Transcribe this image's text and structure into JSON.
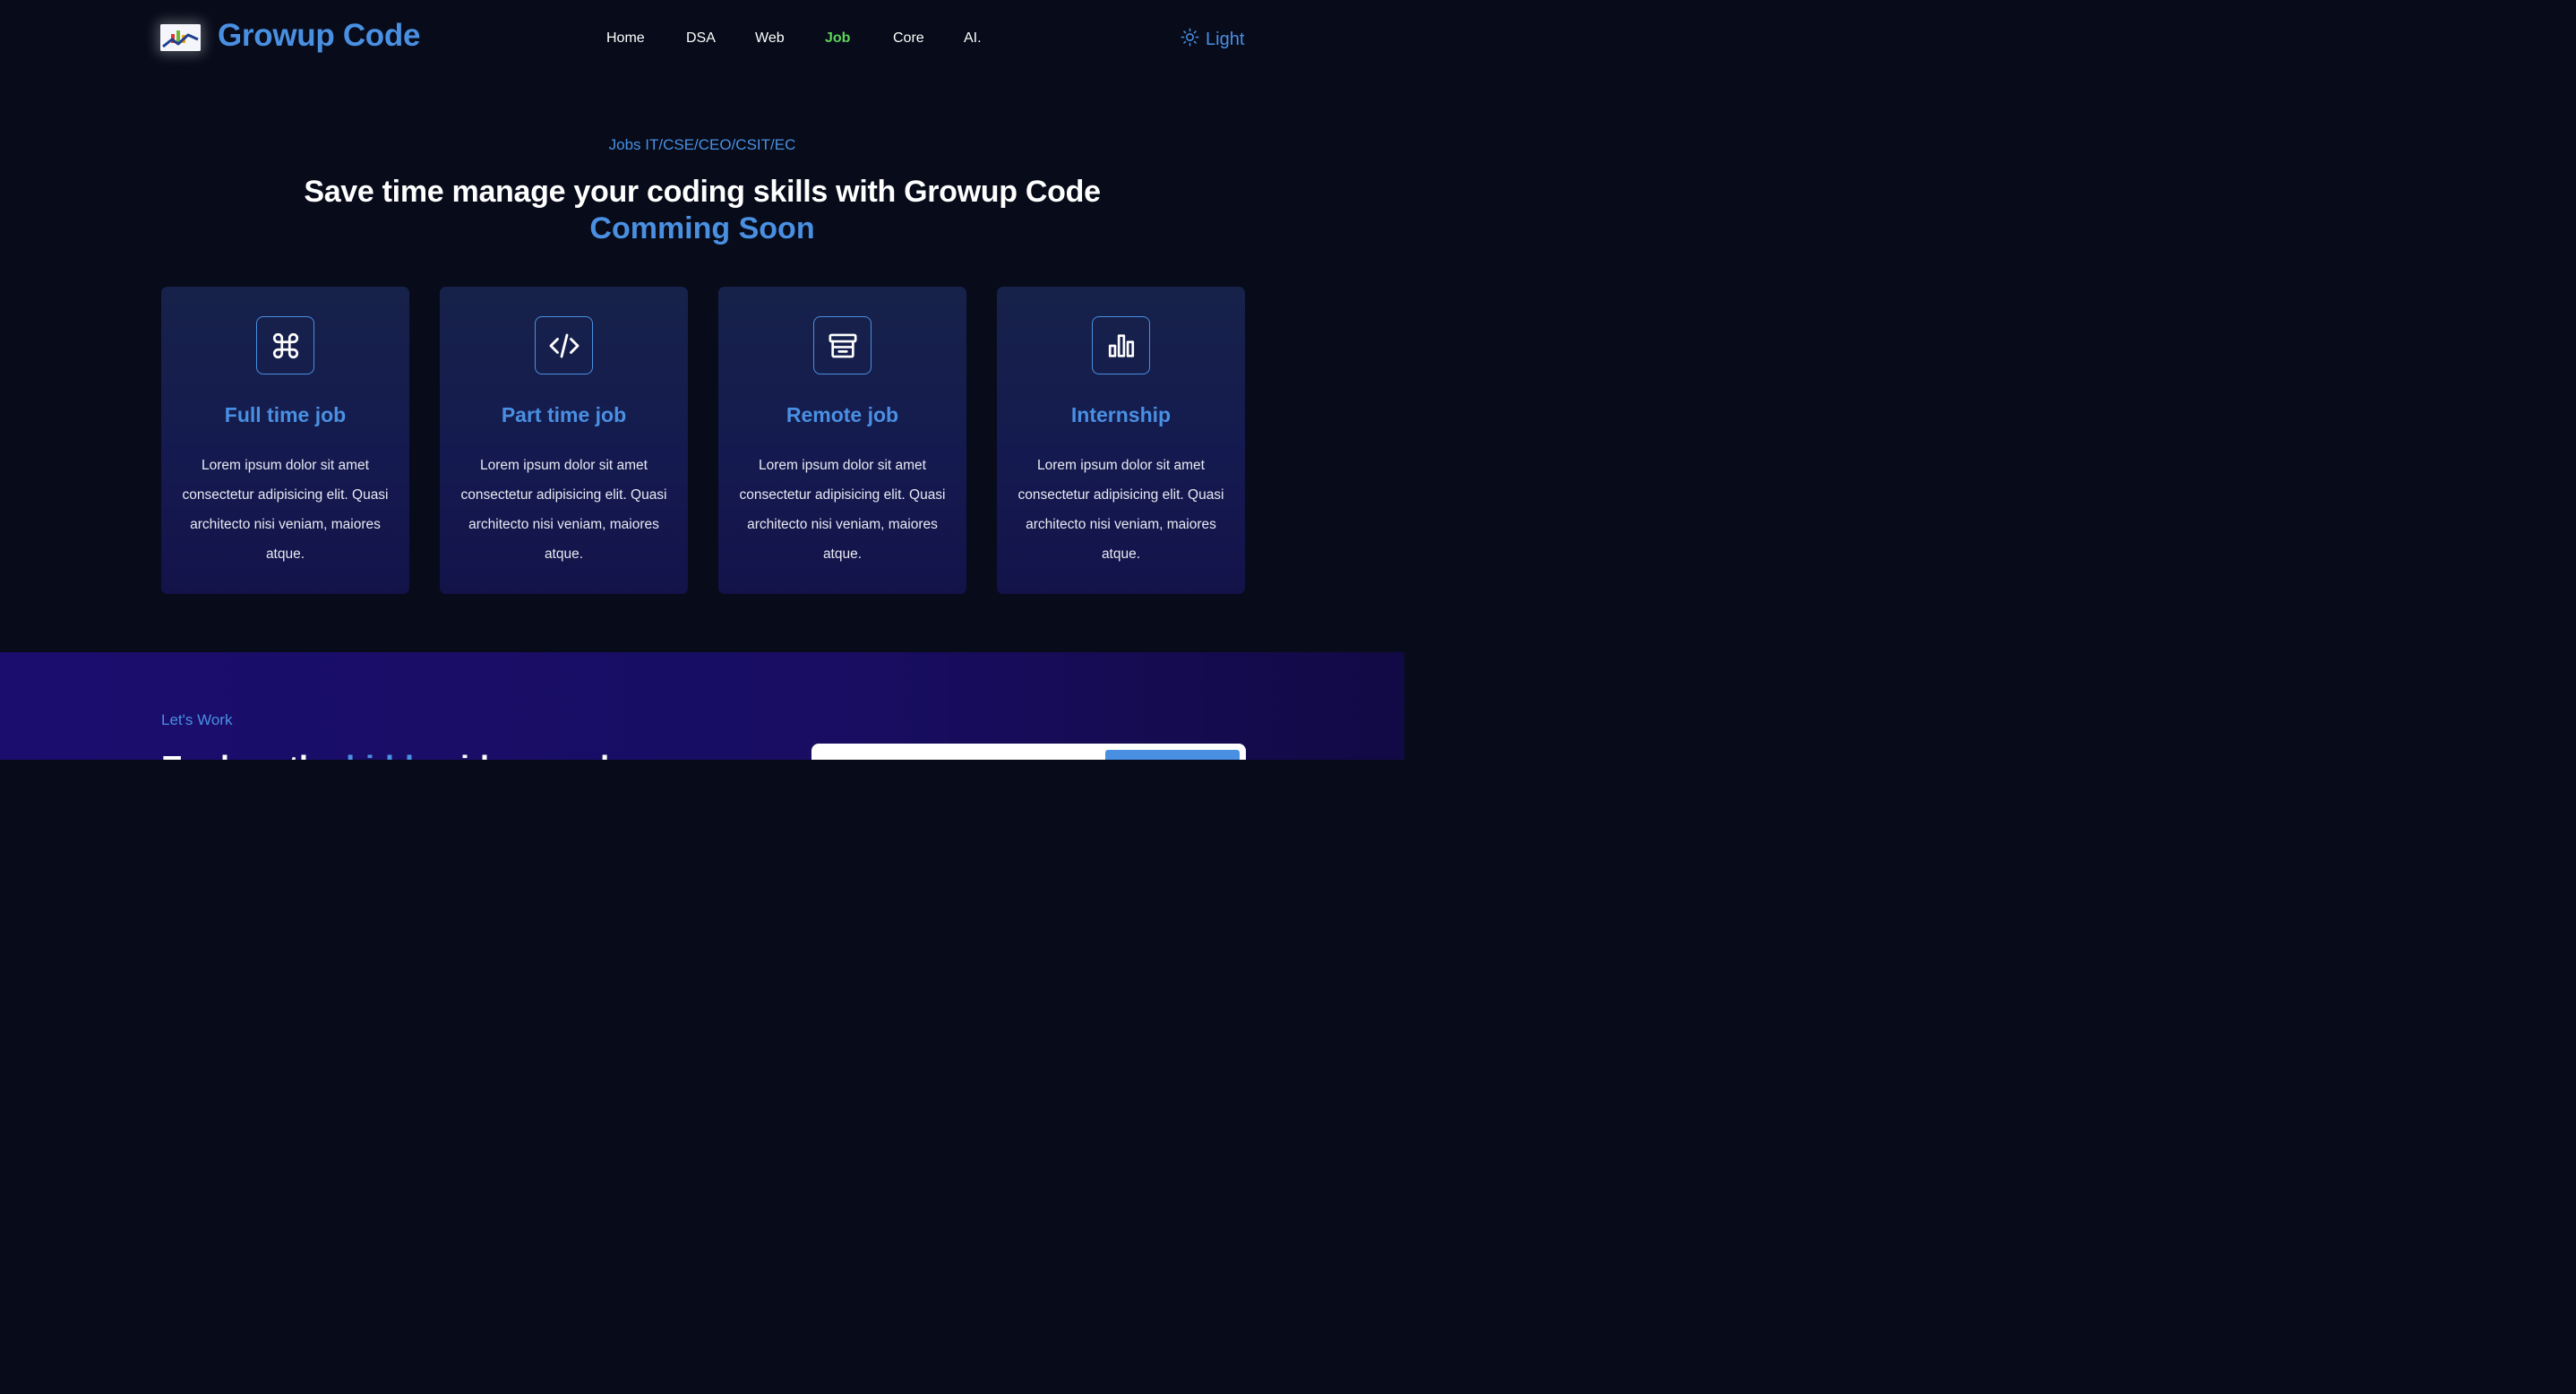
{
  "header": {
    "brand": "Growup Code",
    "nav": [
      {
        "label": "Home"
      },
      {
        "label": "DSA"
      },
      {
        "label": "Web"
      },
      {
        "label": "Job",
        "active": true
      },
      {
        "label": "Core"
      },
      {
        "label": "AI."
      }
    ],
    "theme_toggle": {
      "label": "Light",
      "icon": "sun-icon"
    }
  },
  "hero": {
    "kicker": "Jobs IT/CSE/CEO/CSIT/EC",
    "headline": "Save time manage your coding skills with Growup Code",
    "headline_accent": "Comming Soon"
  },
  "cards": [
    {
      "icon": "command-icon",
      "title": "Full time job",
      "description": "Lorem ipsum dolor sit amet consectetur adipisicing elit. Quasi architecto nisi veniam, maiores atque."
    },
    {
      "icon": "code-icon",
      "title": "Part time job",
      "description": "Lorem ipsum dolor sit amet consectetur adipisicing elit. Quasi architecto nisi veniam, maiores atque."
    },
    {
      "icon": "archive-icon",
      "title": "Remote job",
      "description": "Lorem ipsum dolor sit amet consectetur adipisicing elit. Quasi architecto nisi veniam, maiores atque."
    },
    {
      "icon": "bar-chart-icon",
      "title": "Internship",
      "description": "Lorem ipsum dolor sit amet consectetur adipisicing elit. Quasi architecto nisi veniam, maiores atque."
    }
  ],
  "work": {
    "kicker": "Let's Work",
    "heading_start": "Explore the ",
    "heading_highlight": "hidden",
    "heading_end": " ideas and"
  },
  "colors": {
    "background": "#070b1a",
    "accent": "#4a90e2",
    "active_nav": "#5dd35a",
    "card": "#151c4c",
    "section": "#1a0d6e"
  }
}
